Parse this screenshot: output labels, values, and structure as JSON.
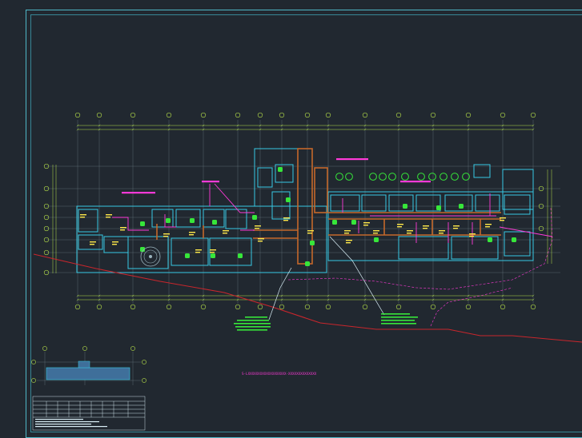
{
  "colors": {
    "background": "#212830",
    "frame_outer": "#4fb6c6",
    "frame_inner": "#3f9fb0",
    "grid_lines": "#6f7f86",
    "dimension": "#b8e24a",
    "walls_cyan": "#38c9e3",
    "corridor_orange": "#c4682a",
    "partition_magenta": "#ff3ad8",
    "equipment_green": "#37e63a",
    "annotation_yellow": "#ffe94a",
    "boundary_red": "#c8262c",
    "leader_white": "#d9eef6"
  },
  "icons": {
    "grid_bubble": "axis-bubble-icon",
    "column": "column-square-icon",
    "fixture": "plant-symbol-icon"
  },
  "drawing": {
    "bottom_note": "S-LXXXXXXXXXXXXXXXXXXX-XXXXXXXXXXXXXX"
  }
}
